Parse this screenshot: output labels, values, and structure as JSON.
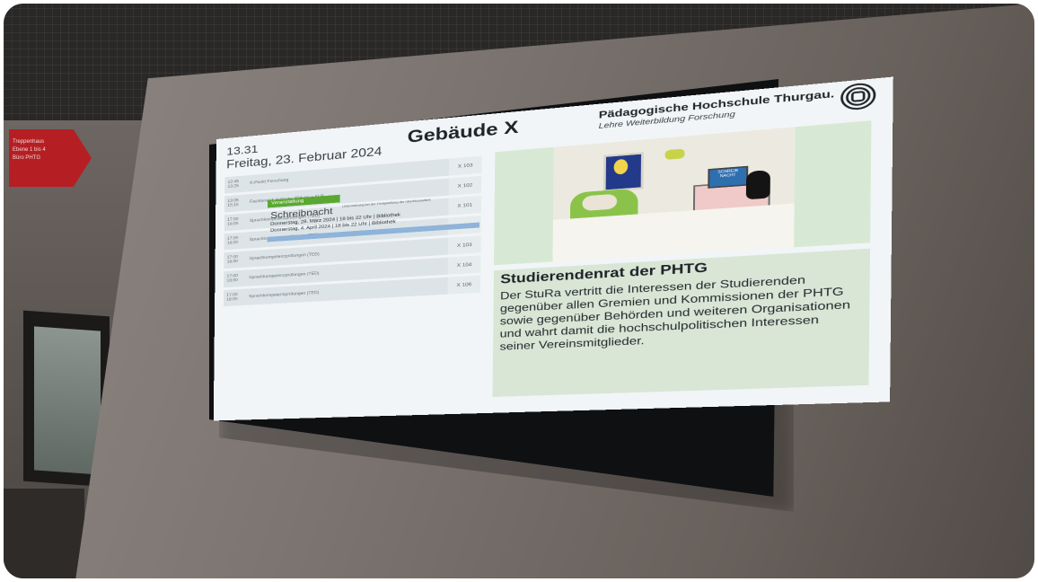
{
  "signage": {
    "time": "13.31",
    "date": "Freitag, 23. Februar 2024",
    "building": "Gebäude X",
    "institution": "Pädagogische Hochschule Thurgau.",
    "tagline": "Lehre Weiterbildung Forschung"
  },
  "schedule": [
    {
      "time": "12:45\n13:25",
      "event": "K-Punkt Forschung",
      "room": "X 103"
    },
    {
      "time": "13:05\n15:15",
      "event": "Fachbereich Kritische Bildung + KUF",
      "room": "X 102"
    },
    {
      "time": "17:00\n18:00",
      "event": "Sprachkompetenzprüfungen (TED)",
      "room": "X 101"
    },
    {
      "time": "17:00\n18:00",
      "event": "Sprachkompetenzprüfungen (TED)",
      "room": "X 102"
    },
    {
      "time": "17:00\n18:00",
      "event": "Sprachkompetenzprüfungen (TED)",
      "room": "X 103"
    },
    {
      "time": "17:00\n18:00",
      "event": "Sprachkompetenzprüfungen (TED)",
      "room": "X 104"
    },
    {
      "time": "17:00\n18:00",
      "event": "Sprachkompetenzprüfungen (TED)",
      "room": "X 106"
    }
  ],
  "poster": {
    "tag": "Veranstaltung",
    "headline": "Schreibnacht",
    "subline": "Unterstützung bei der Fertigstellung der Abschlussarbeit",
    "monitor_text": "SCHREIB NACHT",
    "line1": "Donnerstag, 28. März 2024 | 18 bis 22 Uhr | Bibliothek",
    "line2": "Donnerstag, 4. April 2024 | 18 bis 22 Uhr | Bibliothek"
  },
  "info": {
    "title": "Studierendenrat der PHTG",
    "body": "Der StuRa vertritt die Interessen der Studierenden gegenüber allen Gremien und Kommissionen der PHTG sowie gegenüber Behörden und weiteren Organisationen und wahrt damit die hochschulpolitischen Interessen seiner Vereinsmitglieder."
  },
  "wall_sign": {
    "text": "Treppenhaus\nEbene 1 bis 4\nBüro PHTG"
  },
  "colors": {
    "wall": "#7b7470",
    "screen_bg": "#f1f5f7",
    "poster_green": "#5aa832",
    "sign_red": "#b51f24"
  }
}
